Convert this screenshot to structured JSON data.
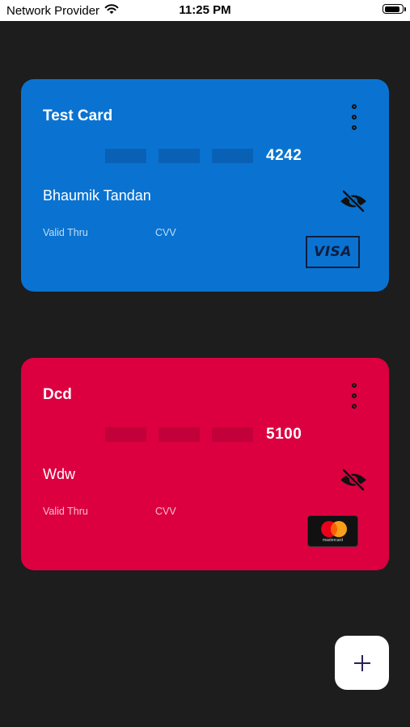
{
  "status_bar": {
    "carrier": "Network Provider",
    "time": "11:25 PM",
    "battery_level": 0.92,
    "wifi_icon": "wifi-icon",
    "battery_icon": "battery-icon"
  },
  "cards": [
    {
      "title": "Test Card",
      "last4": "4242",
      "holder": "Bhaumik Tandan",
      "valid_thru_label": "Valid Thru",
      "cvv_label": "CVV",
      "brand": "VISA",
      "color": "#0a73d1",
      "mask_color": "#0961b6",
      "menu_icon": "more-vertical-icon",
      "visibility_icon": "eye-off-icon"
    },
    {
      "title": "Dcd",
      "last4": "5100",
      "holder": "Wdw",
      "valid_thru_label": "Valid Thru",
      "cvv_label": "CVV",
      "brand": "mastercard",
      "color": "#dc0041",
      "mask_color": "#c20039",
      "menu_icon": "more-vertical-icon",
      "visibility_icon": "eye-off-icon"
    }
  ],
  "fab": {
    "icon": "plus-icon"
  }
}
